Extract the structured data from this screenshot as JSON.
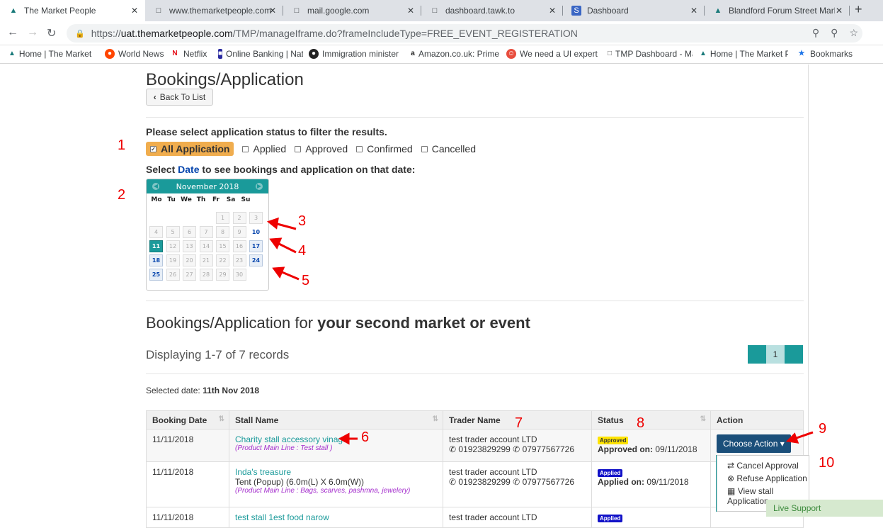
{
  "browser": {
    "tabs": [
      {
        "label": "The Market People",
        "icon": "market-people-logo"
      },
      {
        "label": "www.themarketpeople.com",
        "icon": "page-icon"
      },
      {
        "label": "mail.google.com",
        "icon": "page-icon"
      },
      {
        "label": "dashboard.tawk.to",
        "icon": "page-icon"
      },
      {
        "label": "Dashboard",
        "icon": "dashboard-logo"
      },
      {
        "label": "Blandford Forum Street Marke",
        "icon": "market-people-logo"
      }
    ],
    "url_prefix": "https://",
    "url_host": "uat.themarketpeople.com",
    "url_path": "/TMP/manageIframe.do?frameIncludeType=FREE_EVENT_REGISTERATION",
    "bookmarks": [
      "Home | The Market P",
      "World News",
      "Netflix",
      "Online Banking | Nat",
      "Immigration minister",
      "Amazon.co.uk: Prime",
      "We need a UI expert",
      "TMP Dashboard - Ma",
      "Home | The Market P",
      "Bookmarks"
    ]
  },
  "page": {
    "title": "Bookings/Application",
    "back_label": "Back To List",
    "filter_prompt": "Please select application status to filter the results.",
    "filters": {
      "all": "All Application",
      "options": [
        "Applied",
        "Approved",
        "Confirmed",
        "Cancelled"
      ]
    },
    "date_prompt_prefix": "Select ",
    "date_prompt_date": "Date",
    "date_prompt_suffix": " to see bookings and application on that date:",
    "calendar": {
      "month": "November 2018",
      "days_of_week": [
        "Mo",
        "Tu",
        "We",
        "Th",
        "Fr",
        "Sa",
        "Su"
      ]
    },
    "section_title_prefix": "Bookings/Application for ",
    "section_title_bold": "your second market or event",
    "records_text": "Displaying 1-7 of 7 records",
    "pager_page": "1",
    "selected_date_label": "Selected date: ",
    "selected_date_value": "11th Nov 2018"
  },
  "annotations": [
    "1",
    "2",
    "3",
    "4",
    "5",
    "6",
    "7",
    "8",
    "9",
    "10"
  ],
  "table": {
    "headers": [
      "Booking Date",
      "Stall Name",
      "Trader Name",
      "Status",
      "Action"
    ],
    "rows": [
      {
        "date": "11/11/2018",
        "stall": "Charity stall accessory vinage",
        "stall_detail": "",
        "product": "(Product Main Line : Test stall )",
        "trader": "test trader account LTD",
        "phone1": "01923829299",
        "phone2": "07977567726",
        "badge": "Approved",
        "status_label": "Approved on:",
        "status_date": "09/11/2018",
        "action": "Choose Action"
      },
      {
        "date": "11/11/2018",
        "stall": "Inda's treasure",
        "stall_detail": "Tent (Popup) (6.0m(L) X 6.0m(W))",
        "product": "(Product Main Line : Bags, scarves, pashmna, jewelery)",
        "trader": "test trader account LTD",
        "phone1": "01923829299",
        "phone2": "07977567726",
        "badge": "Applied",
        "status_label": "Applied on:",
        "status_date": "09/11/2018",
        "action": ""
      },
      {
        "date": "11/11/2018",
        "stall": "test stall 1est food narow",
        "trader": "test trader account LTD",
        "badge": "Applied"
      }
    ]
  },
  "action_menu": [
    "Cancel Approval",
    "Refuse Application",
    "View stall",
    "Application"
  ],
  "live_support": "Live Support"
}
